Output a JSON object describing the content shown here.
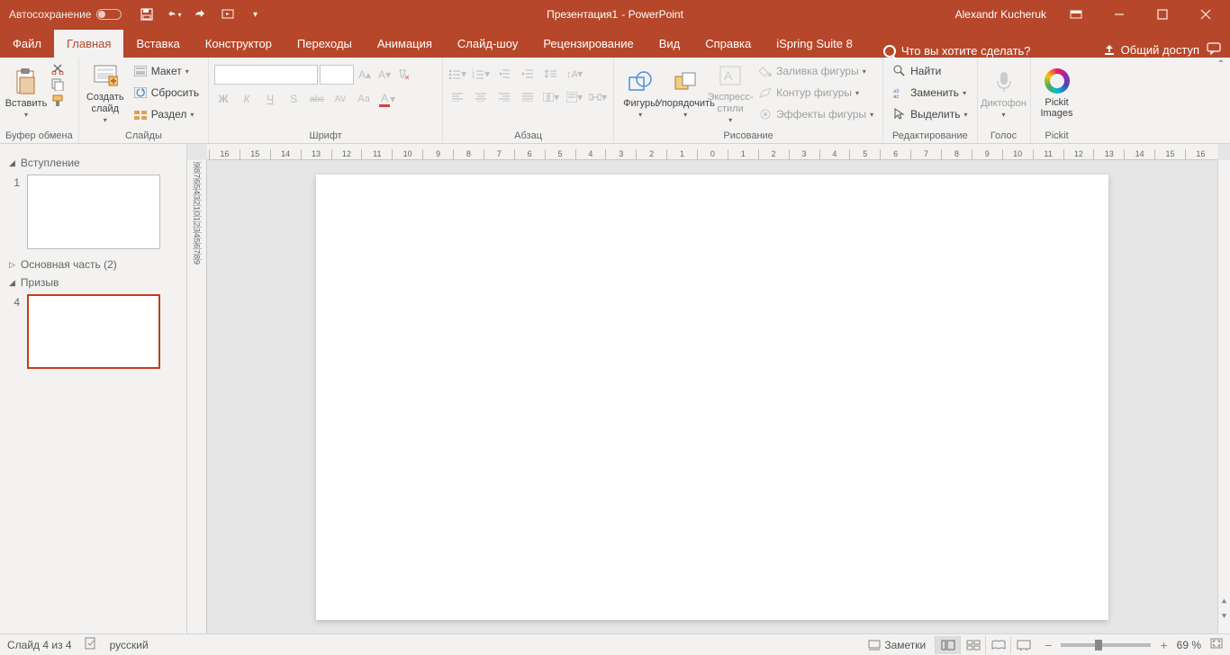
{
  "titlebar": {
    "autosave_label": "Автосохранение",
    "doc_name": "Презентация1",
    "app_suffix": " - PowerPoint",
    "user_name": "Alexandr Kucheruk"
  },
  "tabs": {
    "file": "Файл",
    "home": "Главная",
    "insert": "Вставка",
    "design": "Конструктор",
    "transitions": "Переходы",
    "animations": "Анимация",
    "slideshow": "Слайд-шоу",
    "review": "Рецензирование",
    "view": "Вид",
    "help": "Справка",
    "ispring": "iSpring Suite 8",
    "tell_me": "Что вы хотите сделать?",
    "share": "Общий доступ"
  },
  "ribbon": {
    "clipboard": {
      "label": "Буфер обмена",
      "paste": "Вставить"
    },
    "slides": {
      "label": "Слайды",
      "new_slide": "Создать слайд",
      "layout": "Макет",
      "reset": "Сбросить",
      "section": "Раздел"
    },
    "font": {
      "label": "Шрифт",
      "bold": "Ж",
      "italic": "К",
      "underline": "Ч",
      "shadow": "S",
      "strike": "abc",
      "spacing": "AV",
      "case": "Aa",
      "color": "A"
    },
    "paragraph": {
      "label": "Абзац"
    },
    "drawing": {
      "label": "Рисование",
      "shapes": "Фигуры",
      "arrange": "Упорядочить",
      "quick_styles": "Экспресс-стили",
      "fill": "Заливка фигуры",
      "outline": "Контур фигуры",
      "effects": "Эффекты фигуры"
    },
    "editing": {
      "label": "Редактирование",
      "find": "Найти",
      "replace": "Заменить",
      "select": "Выделить"
    },
    "voice": {
      "label": "Голос",
      "dictate": "Диктофон"
    },
    "pickit": {
      "label": "Pickit",
      "btn": "Pickit Images"
    }
  },
  "sections": {
    "intro": "Вступление",
    "main_part": "Основная часть (2)",
    "cta": "Призыв",
    "slide1_num": "1",
    "slide4_num": "4"
  },
  "ruler_h": [
    "16",
    "15",
    "14",
    "13",
    "12",
    "11",
    "10",
    "9",
    "8",
    "7",
    "6",
    "5",
    "4",
    "3",
    "2",
    "1",
    "0",
    "1",
    "2",
    "3",
    "4",
    "5",
    "6",
    "7",
    "8",
    "9",
    "10",
    "11",
    "12",
    "13",
    "14",
    "15",
    "16"
  ],
  "ruler_v": [
    "9",
    "8",
    "7",
    "6",
    "5",
    "4",
    "3",
    "2",
    "1",
    "0",
    "1",
    "2",
    "3",
    "4",
    "5",
    "6",
    "7",
    "8",
    "9"
  ],
  "status": {
    "slide_count": "Слайд 4 из 4",
    "language": "русский",
    "notes": "Заметки",
    "zoom": "69 %"
  }
}
